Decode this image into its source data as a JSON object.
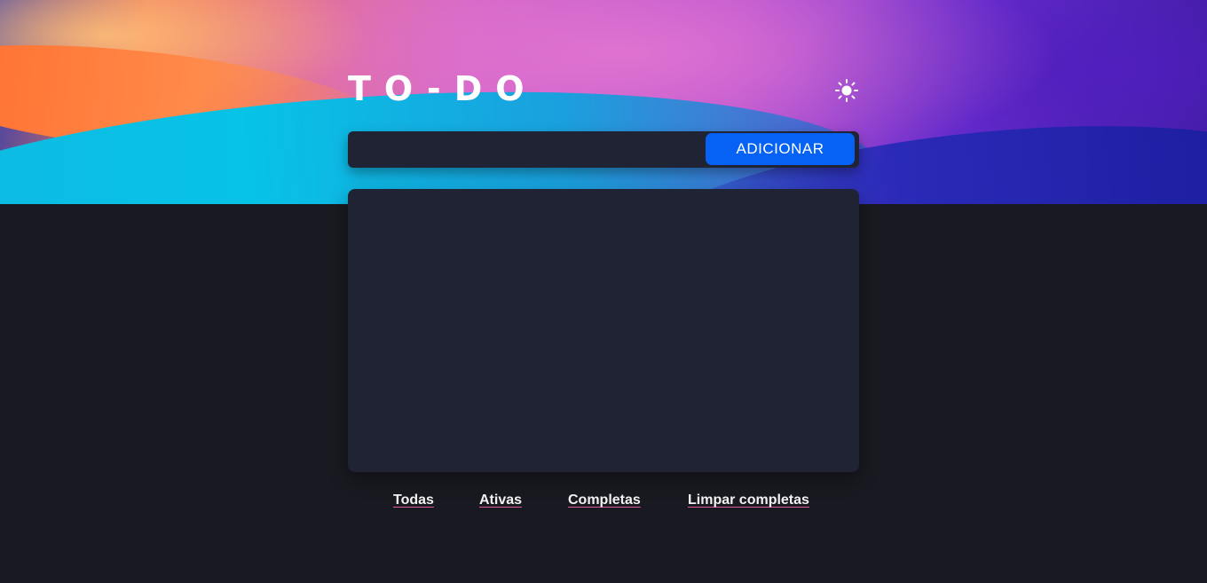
{
  "header": {
    "title": "TO-DO",
    "theme_toggle_icon": "sun-icon"
  },
  "new_task": {
    "value": "",
    "placeholder": "",
    "add_label": "ADICIONAR"
  },
  "task_list": {
    "items": []
  },
  "filters": {
    "all": "Todas",
    "active": "Ativas",
    "completed": "Completas",
    "clear_completed": "Limpar completas"
  },
  "colors": {
    "page_background": "#191921",
    "panel": "#1f2333",
    "accent_button": "#0562f5",
    "filter_underline": "#e0569a"
  }
}
